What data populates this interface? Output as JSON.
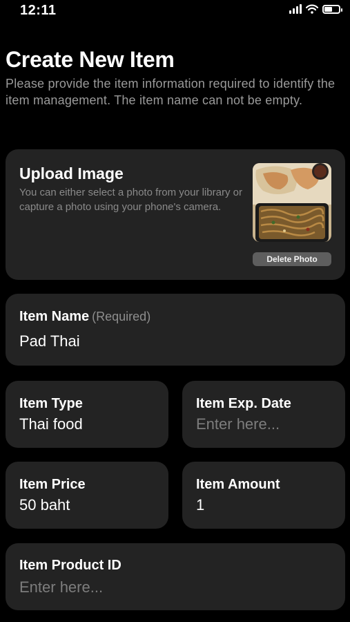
{
  "status_bar": {
    "time": "12:11"
  },
  "header": {
    "title": "Create New Item",
    "description": "Please provide the item information required to identify the item management. The item name can not be empty."
  },
  "upload": {
    "title": "Upload Image",
    "description": "You can either select a photo from your library or capture a photo using your phone's camera.",
    "delete_label": "Delete Photo"
  },
  "fields": {
    "name": {
      "label": "Item Name",
      "hint": "(Required)",
      "value": "Pad Thai"
    },
    "type": {
      "label": "Item Type",
      "value": "Thai food"
    },
    "exp_date": {
      "label": "Item Exp. Date",
      "placeholder": "Enter here..."
    },
    "price": {
      "label": "Item Price",
      "value": "50 baht"
    },
    "amount": {
      "label": "Item Amount",
      "value": "1"
    },
    "product_id": {
      "label": "Item Product ID",
      "placeholder": "Enter here..."
    }
  },
  "icons": [
    "signal-icon",
    "wifi-icon",
    "battery-icon"
  ]
}
